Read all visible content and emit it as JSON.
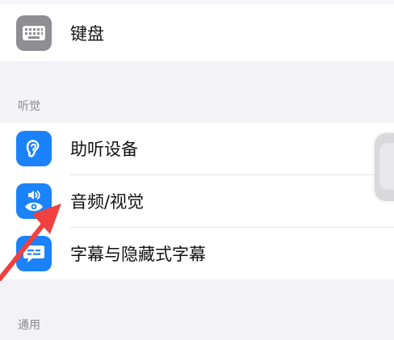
{
  "rows": {
    "keyboard": {
      "label": "键盘",
      "icon": "keyboard-icon",
      "icon_bg": "#8e8e93"
    },
    "hearing_devices": {
      "label": "助听设备",
      "icon": "ear-icon",
      "icon_bg": "#1a82fb"
    },
    "audio_visual": {
      "label": "音频/视觉",
      "icon": "speaker-eye-icon",
      "icon_bg": "#1a82fb"
    },
    "subtitles": {
      "label": "字幕与隐藏式字幕",
      "icon": "caption-bubble-icon",
      "icon_bg": "#1a82fb"
    }
  },
  "sections": {
    "hearing": "听觉",
    "general": "通用"
  },
  "annotation": {
    "arrow_color": "#f04040"
  }
}
